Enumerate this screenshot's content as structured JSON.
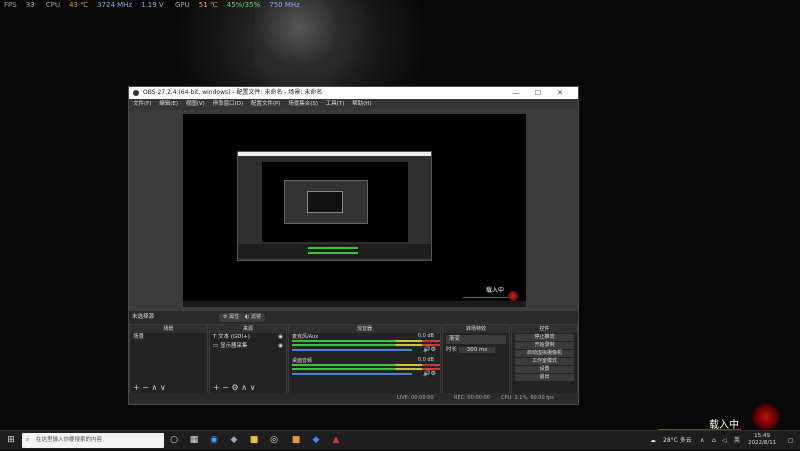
{
  "overlay": {
    "fps_label": "FPS",
    "fps_value": "33",
    "cpu_label": "CPU",
    "cpu_temp": "43 ℃",
    "cpu_clock": "3724 MHz",
    "cpu_voltage": "1.19 V",
    "gpu_label": "GPU",
    "gpu_temp": "51 ℃",
    "gpu_load": "45%/35%",
    "gpu_clock": "750 MHz"
  },
  "window": {
    "title": "OBS 27.2.4 (64-bit, windows) - 配置文件: 未命名 - 场景: 未命名",
    "menu": [
      "文件(F)",
      "编辑(E)",
      "视图(V)",
      "停靠窗口(D)",
      "配置文件(P)",
      "场景集合(S)",
      "工具(T)",
      "帮助(H)"
    ]
  },
  "preview": {
    "loading_text": "载入中"
  },
  "scene_bar": {
    "label": "未选择源",
    "properties": "属性",
    "filters": "滤镜"
  },
  "scenes": {
    "header": "场景",
    "items": [
      "场景"
    ],
    "footer_icons": [
      "+",
      "−",
      "∧",
      "∨"
    ]
  },
  "sources": {
    "header": "来源",
    "items": [
      "文本 (GDI+)",
      "显示器采集"
    ],
    "footer_icons": [
      "+",
      "−",
      "⚙",
      "∧",
      "∨"
    ]
  },
  "mixer": {
    "header": "混音器",
    "channels": [
      {
        "name": "麦克风/Aux",
        "db": "0.0 dB"
      },
      {
        "name": "桌面音频",
        "db": "0.0 dB"
      }
    ]
  },
  "transitions": {
    "header": "转场特效",
    "type": "渐变",
    "duration_label": "时长",
    "duration_value": "300 ms"
  },
  "controls": {
    "header": "控件",
    "buttons": [
      "停止推流",
      "开始录制",
      "启动虚拟摄像机",
      "工作室模式",
      "设置",
      "退出"
    ]
  },
  "status": {
    "live": "LIVE: 00:00:00",
    "rec": "REC: 00:00:00",
    "cpu": "CPU: 3.1%, 60.00 fps"
  },
  "desktop": {
    "loading_text": "载入中"
  },
  "taskbar": {
    "search_placeholder": "在这里输入你要搜索的内容",
    "weather": "28°C 多云",
    "ime": "英",
    "time": "15:49",
    "date": "2022/8/11"
  },
  "colors": {
    "meter_green": "#3fbf3f",
    "meter_yellow": "#c8c83c",
    "meter_red": "#c83c3c",
    "selection": "#1e3d62",
    "accent_red": "#b22222"
  }
}
